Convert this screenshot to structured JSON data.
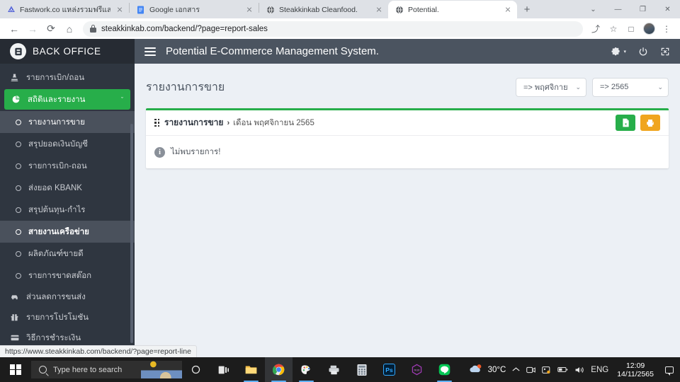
{
  "browser": {
    "tabs": [
      {
        "title": "Fastwork.co แหล่งรวมฟรีแลนซ์คุณภ",
        "favicon": "fastwork-icon",
        "active": false
      },
      {
        "title": "Google เอกสาร",
        "favicon": "google-docs-icon",
        "active": false
      },
      {
        "title": "Steakkinkab Cleanfood.",
        "favicon": "globe-icon",
        "active": false
      },
      {
        "title": "Potential.",
        "favicon": "globe-icon",
        "active": true
      }
    ],
    "newtab_label": "+",
    "window_controls": {
      "minimize": "—",
      "maximize": "❐",
      "close": "✕",
      "chevron": "⌄"
    },
    "toolbar": {
      "back": "←",
      "forward": "→",
      "reload": "⟳",
      "home": "⌂",
      "url": "steakkinkab.com/backend/?page=report-sales",
      "share": "⤴",
      "bookmark": "☆",
      "sidepanel": "□",
      "menu": "⋮"
    }
  },
  "status_bubble": {
    "url": "https://www.steakkinkab.com/backend/?page=report-line"
  },
  "sidebar": {
    "brand": {
      "logo_letter": "Ⓐ",
      "text": "BACK  OFFICE"
    },
    "items": [
      {
        "label": "รายการเบิก/ถอน",
        "icon": "stamp-icon",
        "type": "item"
      },
      {
        "label": "สถิติและรายงาน",
        "icon": "pie-chart-icon",
        "type": "group-active",
        "caret": "ˇ"
      },
      {
        "label": "รายงานการขาย",
        "type": "sub",
        "state": "selected"
      },
      {
        "label": "สรุปยอดเงินบัญชี",
        "type": "sub",
        "state": "normal"
      },
      {
        "label": "รายการเบิก-ถอน",
        "type": "sub",
        "state": "normal"
      },
      {
        "label": "ส่งยอด KBANK",
        "type": "sub",
        "state": "normal"
      },
      {
        "label": "สรุปต้นทุน-กำไร",
        "type": "sub",
        "state": "normal"
      },
      {
        "label": "สายงานเครือข่าย",
        "type": "sub",
        "state": "hover"
      },
      {
        "label": "ผลิตภัณฑ์ขายดี",
        "type": "sub",
        "state": "normal"
      },
      {
        "label": "รายการขาดสต๊อก",
        "type": "sub",
        "state": "normal"
      },
      {
        "label": "ส่วนลดการขนส่ง",
        "icon": "truck-icon",
        "type": "item"
      },
      {
        "label": "รายการโปรโมชัน",
        "icon": "gift-icon",
        "type": "item"
      },
      {
        "label": "วิธีการชำระเงิน",
        "icon": "card-icon",
        "type": "item"
      }
    ]
  },
  "topbar": {
    "menu_toggle": "hamburger-icon",
    "title": "Potential E-Commerce Management System.",
    "icons": [
      {
        "name": "gear-icon",
        "glyph": "⚙",
        "caret": "▾"
      },
      {
        "name": "power-icon",
        "glyph": "⏻"
      },
      {
        "name": "fullscreen-icon",
        "glyph": "⛶"
      }
    ]
  },
  "page": {
    "title": "รายงานการขาย",
    "month_select": {
      "value": "=> พฤศจิกาย",
      "chevron": "⌄"
    },
    "year_select": {
      "value": "=> 2565",
      "chevron": "⌄"
    }
  },
  "card": {
    "title": "รายงานการขาย",
    "separator": "›",
    "subtitle": "เดือน พฤศจิกายน 2565",
    "actions": [
      {
        "name": "export-excel-button",
        "glyph": "ᵡ",
        "label": "x",
        "color": "#27ae4a"
      },
      {
        "name": "print-button",
        "glyph": "⎙",
        "color": "#f0a51e"
      }
    ],
    "info_icon": "i",
    "empty_message": "ไม่พบรายการ!"
  },
  "taskbar": {
    "search_placeholder": "Type here to search",
    "apps": [
      {
        "name": "cortana-icon",
        "glyph": "○"
      },
      {
        "name": "task-view-icon",
        "glyph": "⧉"
      },
      {
        "name": "file-explorer-icon",
        "glyph": "Ὄ1"
      },
      {
        "name": "chrome-icon",
        "glyph": "●"
      },
      {
        "name": "paint-icon",
        "glyph": "✎"
      },
      {
        "name": "printer-icon",
        "glyph": "⎙"
      },
      {
        "name": "calculator-icon",
        "glyph": "⊞"
      },
      {
        "name": "photoshop-icon",
        "glyph": "Ps"
      },
      {
        "name": "nox-icon",
        "glyph": "⬡"
      },
      {
        "name": "line-icon",
        "glyph": "LINE"
      }
    ],
    "weather": {
      "temp": "30°C",
      "icon": "partly-cloudy-icon"
    },
    "tray": [
      {
        "name": "show-hidden-icons",
        "glyph": "⌃"
      },
      {
        "name": "camera-icon",
        "glyph": "▣"
      },
      {
        "name": "onedrive-icon",
        "glyph": "☁"
      },
      {
        "name": "battery-icon",
        "glyph": "▭"
      },
      {
        "name": "volume-icon",
        "glyph": "🔊"
      }
    ],
    "language": "ENG",
    "clock": {
      "time": "12:09",
      "date": "14/11/2565"
    },
    "notification": "notification-icon"
  }
}
